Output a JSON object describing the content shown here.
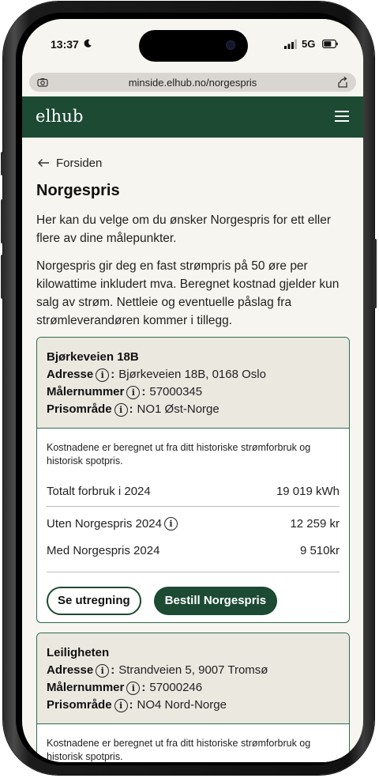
{
  "status_bar": {
    "time": "13:37",
    "network": "5G"
  },
  "browser": {
    "url": "minside.elhub.no/norgespris"
  },
  "header": {
    "logo": "elhub"
  },
  "page": {
    "back_label": "Forsiden",
    "title": "Norgespris",
    "intro": "Her kan du velge om du ønsker Norgespris for ett eller flere av dine målepunkter.",
    "description": "Norgespris gir deg en fast strømpris på 50 øre per kilowattime inkludert mva. Beregnet kostnad gjelder kun salg av strøm. Nettleie og eventuelle påslag fra strømleverandøren kommer i tillegg."
  },
  "labels": {
    "address": "Adresse",
    "meter_number": "Målernummer",
    "price_area": "Prisområde"
  },
  "properties": [
    {
      "name": "Bjørkeveien 18B",
      "address": "Bjørkeveien 18B, 0168 Oslo",
      "meter_number": "57000345",
      "price_area": "NO1 Øst-Norge",
      "note": "Kostnadene er beregnet ut fra ditt historiske strømforbruk og historisk spotpris.",
      "total_label": "Totalt forbruk i 2024",
      "total_value": "19 019 kWh",
      "without_label": "Uten Norgespris 2024",
      "without_value": "12 259 kr",
      "with_label": "Med Norgespris 2024",
      "with_value": "9 510kr",
      "see_calc_button": "Se utregning",
      "order_button": "Bestill Norgespris"
    },
    {
      "name": "Leiligheten",
      "address": "Strandveien 5, 9007 Tromsø",
      "meter_number": "57000246",
      "price_area": "NO4 Nord-Norge",
      "note": "Kostnadene er beregnet ut fra ditt historiske strømforbruk og historisk spotpris."
    }
  ],
  "colors": {
    "brand_green": "#1c4a33",
    "page_bg": "#f7f5ef",
    "card_header_bg": "#ebe8e0"
  },
  "icons": [
    "moon-icon",
    "signal-icon",
    "battery-icon",
    "camera-icon",
    "share-icon",
    "menu-icon",
    "arrow-left-icon",
    "info-icon"
  ]
}
